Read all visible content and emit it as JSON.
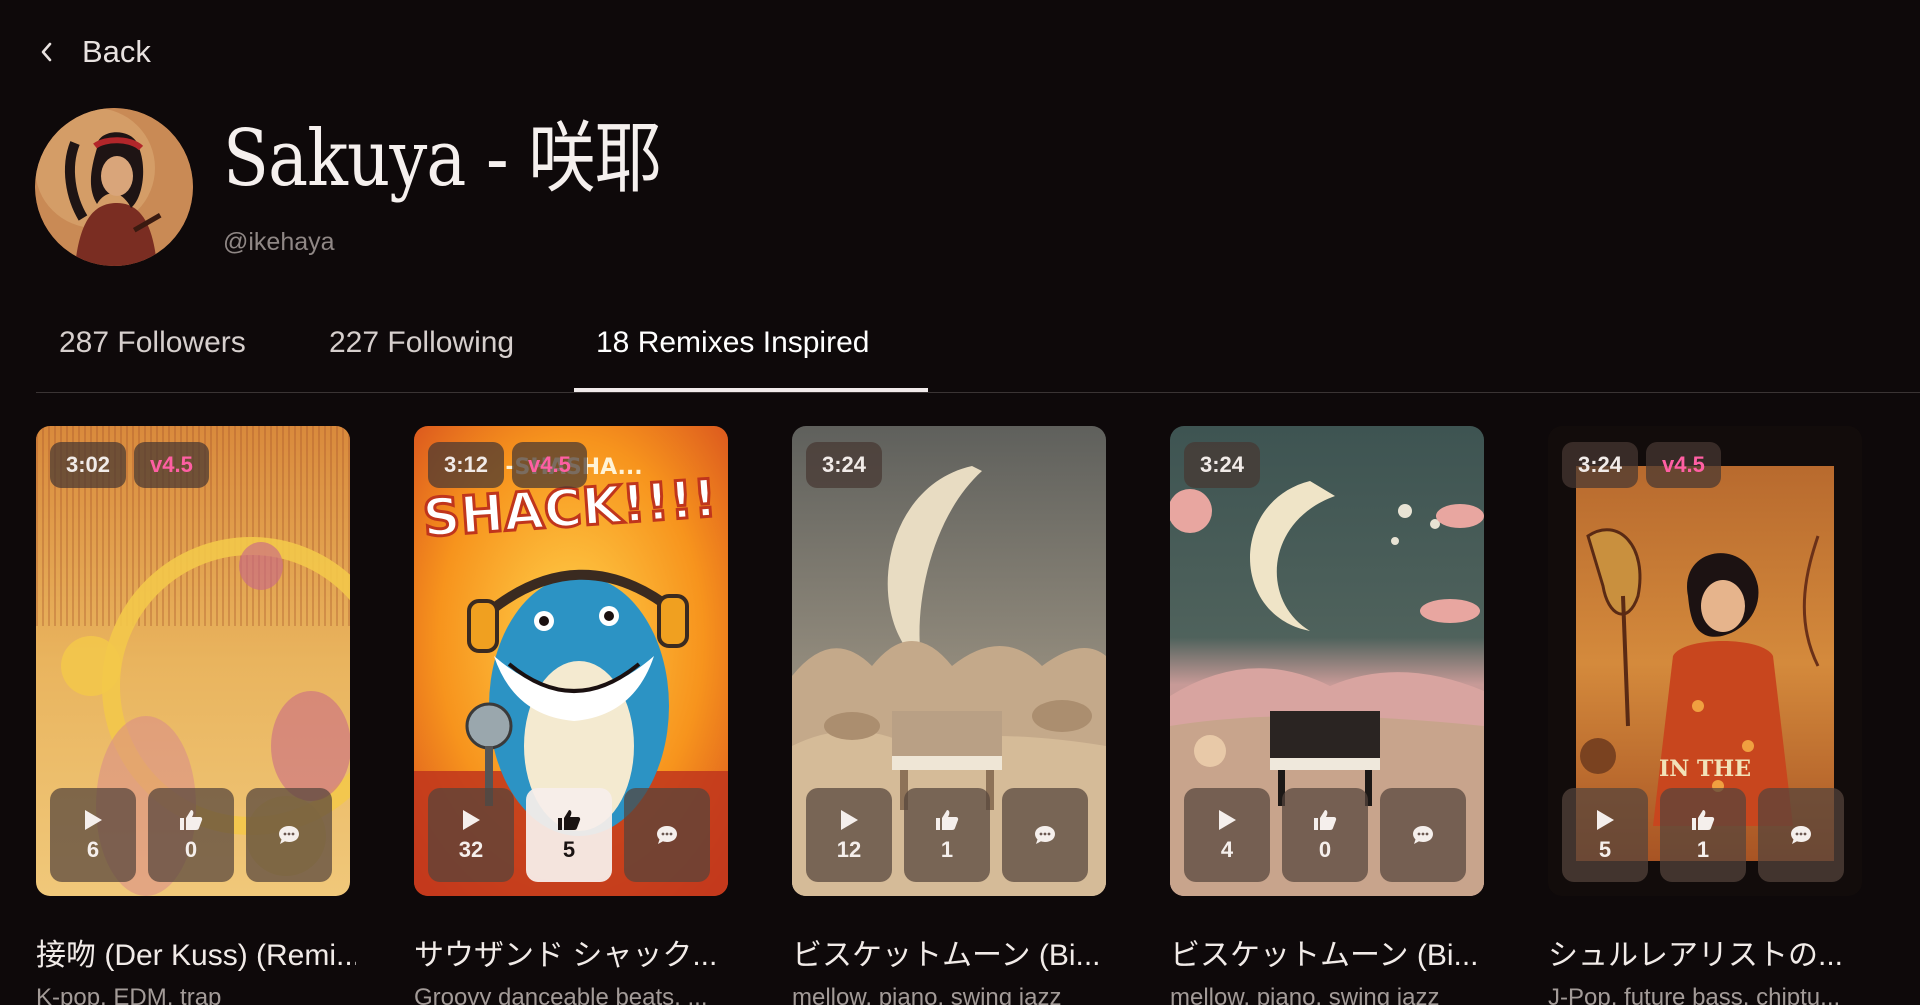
{
  "nav": {
    "back_label": "Back"
  },
  "profile": {
    "display_name": "Sakuya - 咲耶",
    "handle": "@ikehaya"
  },
  "tabs": [
    {
      "label": "287 Followers"
    },
    {
      "label": "227 Following"
    },
    {
      "label": "18 Remixes Inspired",
      "active": true
    }
  ],
  "songs": [
    {
      "duration": "3:02",
      "version": "v4.5",
      "plays": "6",
      "likes": "0",
      "title": "接吻 (Der Kuss) (Remi...",
      "tags": "K-pop, EDM, trap"
    },
    {
      "duration": "3:12",
      "version": "v4.5",
      "plays": "32",
      "likes": "5",
      "likes_highlighted": true,
      "title": "サウザンド シャック...",
      "tags": "Groovy danceable beats, ..."
    },
    {
      "duration": "3:24",
      "version": "",
      "plays": "12",
      "likes": "1",
      "title": "ビスケットムーン (Bi...",
      "tags": "mellow, piano, swing jazz"
    },
    {
      "duration": "3:24",
      "version": "",
      "plays": "4",
      "likes": "0",
      "title": "ビスケットムーン (Bi...",
      "tags": "mellow, piano, swing jazz"
    },
    {
      "duration": "3:24",
      "version": "v4.5",
      "plays": "5",
      "likes": "1",
      "title": "シュルレアリストの...",
      "tags": "J-Pop, future bass, chiptu..."
    }
  ],
  "cover_art": {
    "card2_headline": "SHACK!!!!",
    "card2_subline": "-SHASHA...",
    "card5_caption": "IN THE"
  },
  "colors": {
    "version_badge": "#ff5fa3",
    "background": "#0e090a"
  }
}
